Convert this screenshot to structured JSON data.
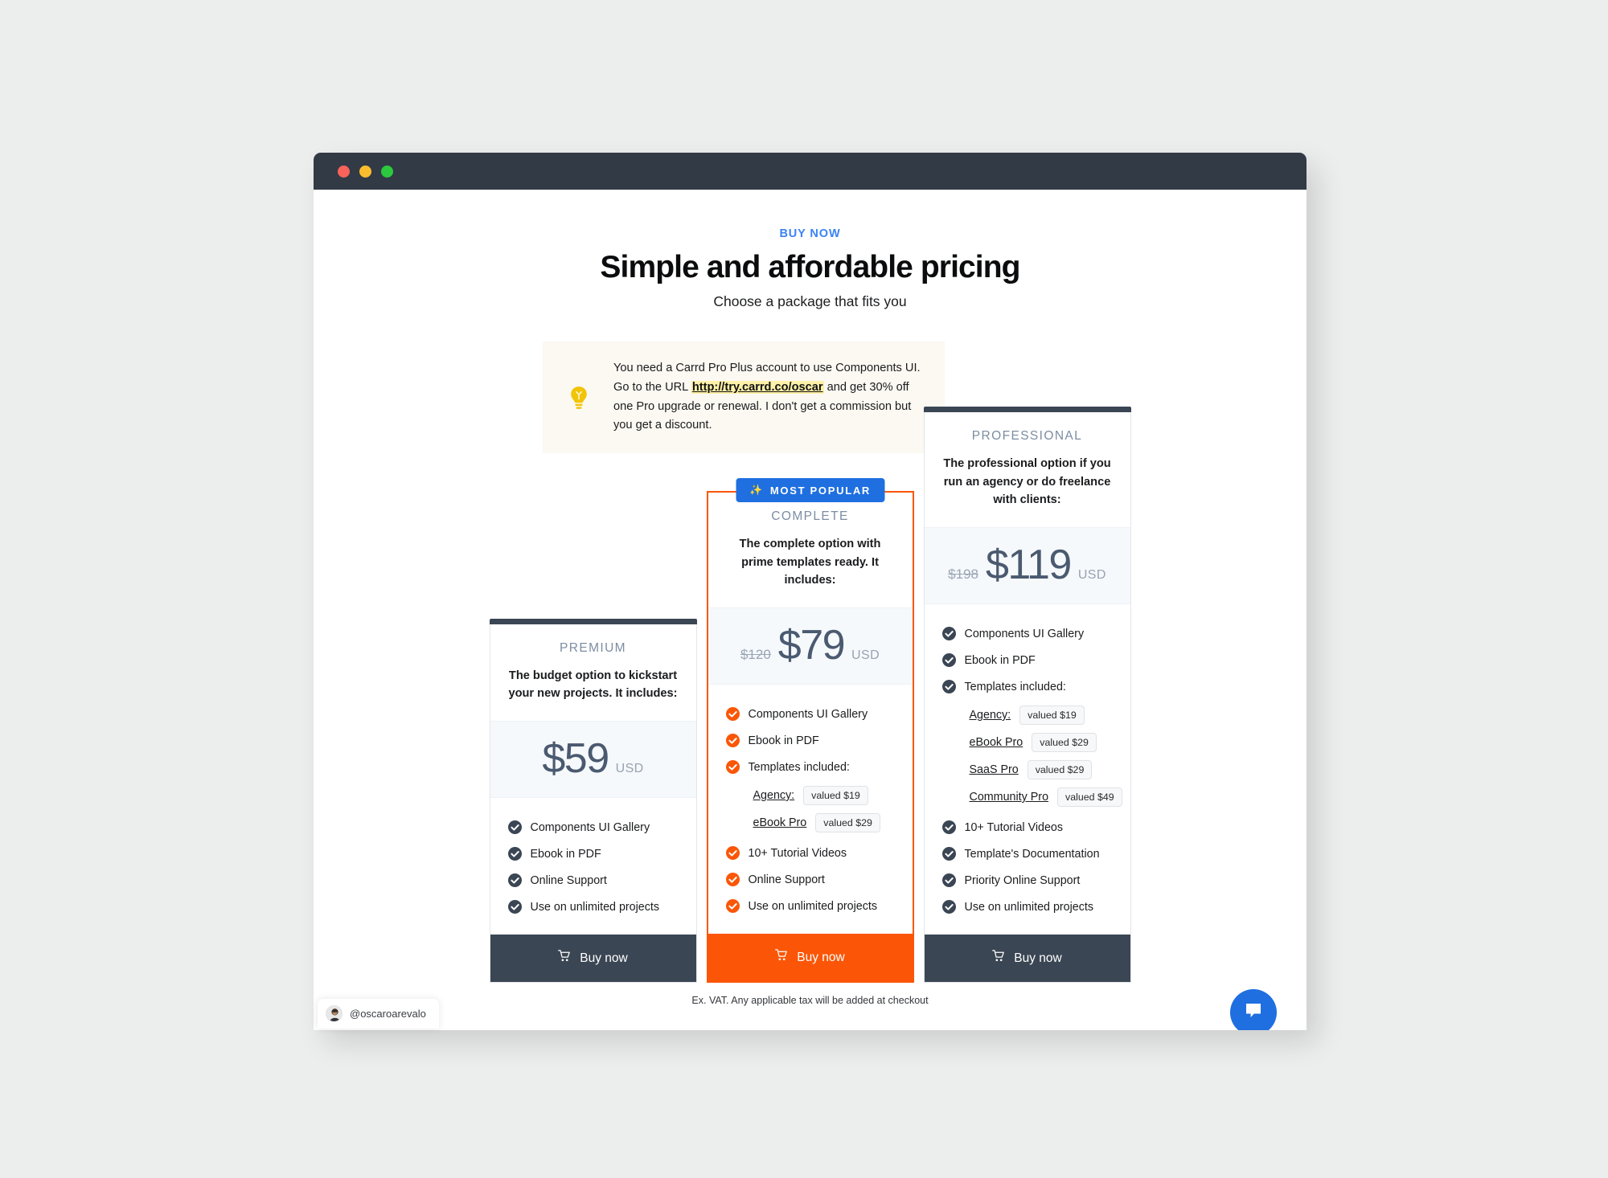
{
  "window": {
    "traffic_lights": [
      "close",
      "minimize",
      "maximize"
    ]
  },
  "header": {
    "eyebrow": "BUY NOW",
    "title": "Simple and affordable pricing",
    "subtitle": "Choose a package that fits you"
  },
  "notice": {
    "icon": "lightbulb-icon",
    "text_before": "You need a Carrd Pro Plus account to use Components UI. Go to the URL ",
    "link": "http://try.carrd.co/oscar",
    "text_after": " and get 30% off one Pro upgrade or renewal. I don't get a commission but you get a discount."
  },
  "plans": [
    {
      "id": "premium",
      "name": "PREMIUM",
      "description": "The budget option to kickstart your new projects. It includes:",
      "old_price": "",
      "price": "$59",
      "currency": "USD",
      "accent": "#3b4654",
      "features": [
        "Components UI Gallery",
        "Ebook in PDF",
        "Online Support",
        "Use on unlimited projects"
      ],
      "templates": [],
      "cta": "Buy now"
    },
    {
      "id": "complete",
      "name": "COMPLETE",
      "badge": "MOST POPULAR",
      "badge_icon": "sparkles-icon",
      "description": "The complete option with prime templates ready. It includes:",
      "old_price": "$120",
      "price": "$79",
      "currency": "USD",
      "accent": "#fb5607",
      "features": [
        "Components UI Gallery",
        "Ebook in PDF",
        "Templates included:",
        "10+ Tutorial Videos",
        "Online Support",
        "Use on unlimited projects"
      ],
      "templates": [
        {
          "name": "Agency:",
          "value": "valued $19"
        },
        {
          "name": "eBook Pro",
          "value": "valued $29"
        }
      ],
      "templates_after_index": 2,
      "cta": "Buy now"
    },
    {
      "id": "professional",
      "name": "PROFESSIONAL",
      "description": "The professional option if you run an agency or do freelance with clients:",
      "old_price": "$198",
      "price": "$119",
      "currency": "USD",
      "accent": "#3b4654",
      "features": [
        "Components UI Gallery",
        "Ebook in PDF",
        "Templates included:",
        "10+ Tutorial Videos",
        "Template's Documentation",
        "Priority Online Support",
        "Use on unlimited projects"
      ],
      "templates": [
        {
          "name": "Agency:",
          "value": "valued $19"
        },
        {
          "name": "eBook Pro",
          "value": "valued $29"
        },
        {
          "name": "SaaS Pro",
          "value": "valued $29"
        },
        {
          "name": "Community Pro",
          "value": "valued $49"
        }
      ],
      "templates_after_index": 2,
      "cta": "Buy now"
    }
  ],
  "footnote": "Ex. VAT. Any applicable tax will be added at checkout",
  "chat": {
    "icon": "chat-bubble-icon"
  },
  "watermark": {
    "handle": "@oscaroarevalo"
  },
  "colors": {
    "accent_blue": "#3b82f6",
    "badge_blue": "#1f6fe0",
    "orange": "#fb5607",
    "dark": "#3b4654",
    "price_band": "#f6f9fc"
  }
}
